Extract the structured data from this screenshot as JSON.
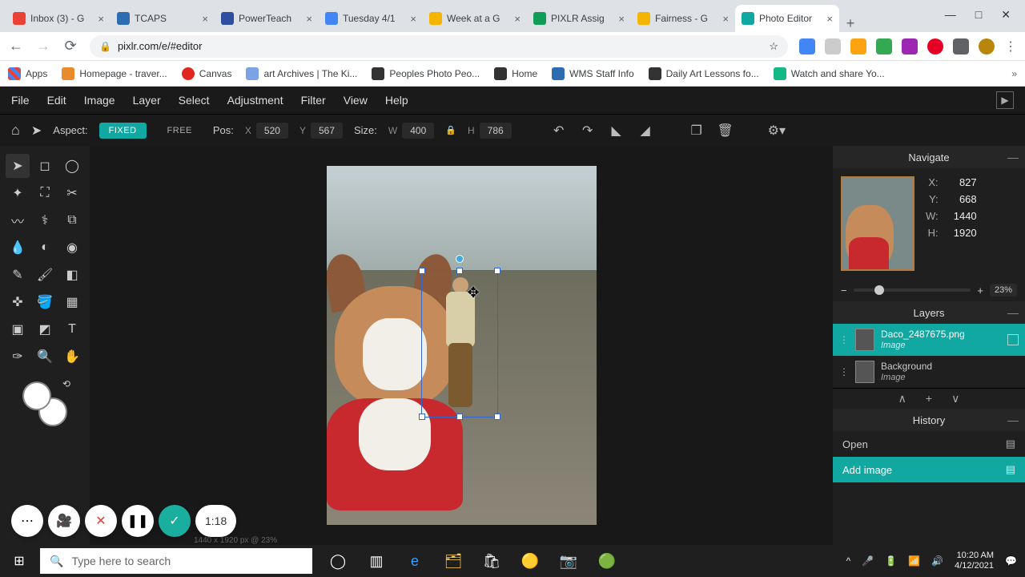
{
  "window": {
    "min": "—",
    "max": "□",
    "close": "✕"
  },
  "tabs": [
    {
      "title": "Inbox (3) - G",
      "favicon": "#ea4335"
    },
    {
      "title": "TCAPS",
      "favicon": "#2b6db0"
    },
    {
      "title": "PowerTeach",
      "favicon": "#2f4ea1"
    },
    {
      "title": "Tuesday 4/1",
      "favicon": "#4285f4"
    },
    {
      "title": "Week at a G",
      "favicon": "#f4b400"
    },
    {
      "title": "PIXLR Assig",
      "favicon": "#0f9d58"
    },
    {
      "title": "Fairness - G",
      "favicon": "#f4b400"
    },
    {
      "title": "Photo Editor",
      "favicon": "#12a8a2",
      "active": true
    }
  ],
  "addressbar": {
    "url": "pixlr.com/e/#editor",
    "star": "☆"
  },
  "bookmarks": [
    {
      "label": "Apps",
      "color": "#5f6368"
    },
    {
      "label": "Homepage - traver...",
      "color": "#e98b2c"
    },
    {
      "label": "Canvas",
      "color": "#e2261d"
    },
    {
      "label": "art Archives | The Ki...",
      "color": "#7aa3e5"
    },
    {
      "label": "Peoples Photo Peo...",
      "color": "#333"
    },
    {
      "label": "Home",
      "color": "#333"
    },
    {
      "label": "WMS Staff Info",
      "color": "#2b6db0"
    },
    {
      "label": "Daily Art Lessons fo...",
      "color": "#333"
    },
    {
      "label": "Watch and share Yo...",
      "color": "#12b886"
    }
  ],
  "menu": [
    "File",
    "Edit",
    "Image",
    "Layer",
    "Select",
    "Adjustment",
    "Filter",
    "View",
    "Help"
  ],
  "options": {
    "aspect_label": "Aspect:",
    "fixed": "FIXED",
    "free": "FREE",
    "pos_label": "Pos:",
    "pos_x_lbl": "X",
    "pos_x": "520",
    "pos_y_lbl": "Y",
    "pos_y": "567",
    "size_label": "Size:",
    "size_w_lbl": "W",
    "size_w": "400",
    "size_h_lbl": "H",
    "size_h": "786"
  },
  "navigate": {
    "title": "Navigate",
    "x_lbl": "X:",
    "x": "827",
    "y_lbl": "Y:",
    "y": "668",
    "w_lbl": "W:",
    "w": "1440",
    "h_lbl": "H:",
    "h": "1920",
    "zoom_minus": "−",
    "zoom_plus": "+",
    "zoom": "23%"
  },
  "layers": {
    "title": "Layers",
    "items": [
      {
        "name": "Daco_2487675.png",
        "type": "Image",
        "active": true
      },
      {
        "name": "Background",
        "type": "Image",
        "active": false
      }
    ],
    "up": "∧",
    "add": "+",
    "down": "∨"
  },
  "history": {
    "title": "History",
    "items": [
      {
        "label": "Open",
        "active": false
      },
      {
        "label": "Add image",
        "active": true
      }
    ]
  },
  "canvas_footer": "1440 x 1920 px @ 23%",
  "recording": {
    "more": "⋯",
    "cam": "🎥",
    "cancel": "✕",
    "pause": "❚❚",
    "ok": "✓",
    "time": "1:18"
  },
  "taskbar": {
    "search_placeholder": "Type here to search",
    "time": "10:20 AM",
    "date": "4/12/2021"
  }
}
